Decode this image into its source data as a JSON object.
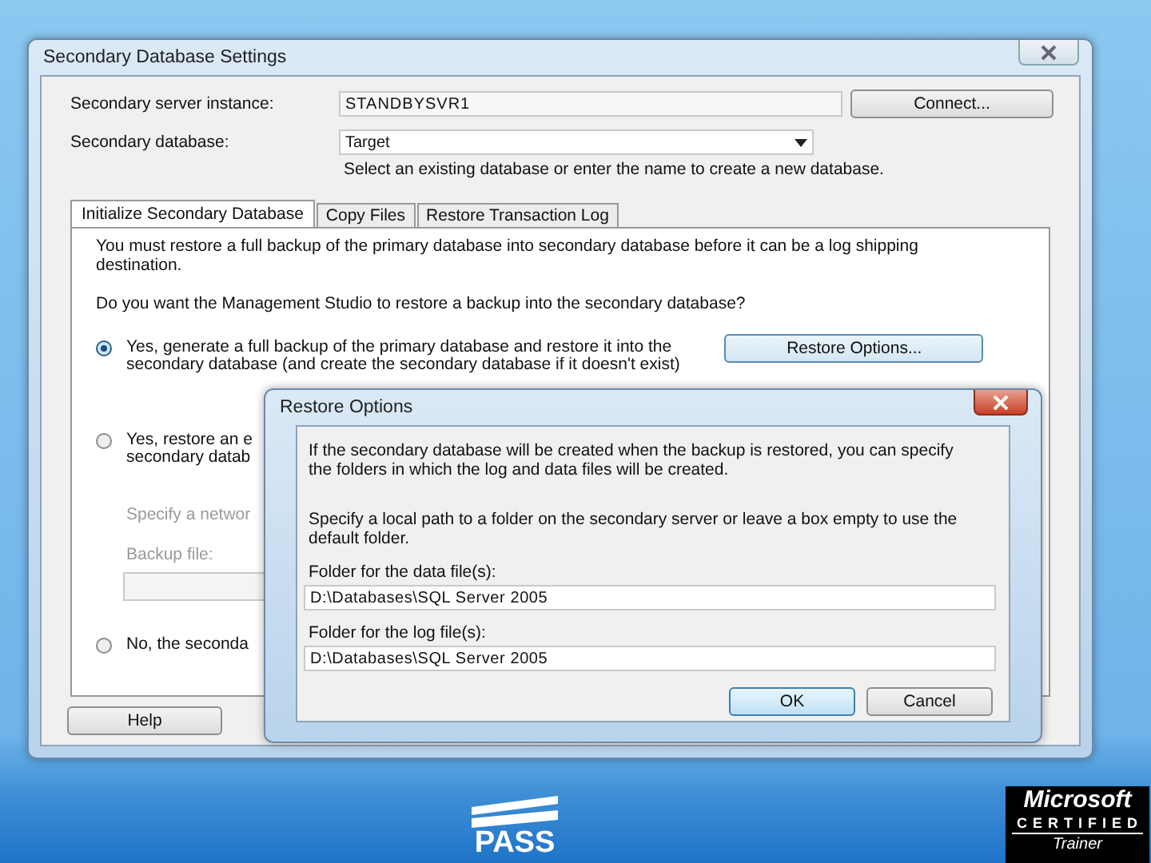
{
  "main_dialog": {
    "title": "Secondary Database Settings",
    "server_label": "Secondary server instance:",
    "server_value": "STANDBYSVR1",
    "connect_button": "Connect...",
    "database_label": "Secondary database:",
    "database_value": "Target",
    "database_hint": "Select an existing database or enter the name to create a new database.",
    "tabs": [
      {
        "label": "Initialize Secondary Database",
        "selected": true
      },
      {
        "label": "Copy Files",
        "selected": false
      },
      {
        "label": "Restore Transaction Log",
        "selected": false
      }
    ],
    "intro": "You must restore a full backup of the primary database into secondary database before it can be a log shipping destination.",
    "question": "Do you want the Management Studio to restore a backup into the secondary database?",
    "options": [
      {
        "kind": "radio",
        "selected": true,
        "lines": [
          "Yes, generate a full backup of the primary database and restore it into the",
          "secondary database (and create the secondary database if it doesn't exist)"
        ],
        "button": "Restore Options..."
      },
      {
        "kind": "radio",
        "selected": false,
        "lines": [
          "Yes, restore an e",
          "secondary datab"
        ]
      },
      {
        "kind": "note",
        "disabled": true,
        "text": "Specify a networ"
      },
      {
        "kind": "field",
        "disabled": true,
        "label": "Backup file:"
      },
      {
        "kind": "radio",
        "selected": false,
        "lines": [
          "No, the seconda"
        ]
      }
    ],
    "help_button": "Help"
  },
  "restore_options": {
    "title": "Restore Options",
    "text1": "If the secondary database will be created when the backup is restored, you can specify the folders in which the log and data files will be created.",
    "text2": "Specify a local path to a folder on the secondary server or leave a box empty to use the default folder.",
    "fields": [
      {
        "label": "Folder for the data file(s):",
        "value": "D:\\Databases\\SQL Server 2005"
      },
      {
        "label": "Folder for the log file(s):",
        "value": "D:\\Databases\\SQL Server 2005"
      }
    ],
    "buttons": [
      {
        "label": "OK",
        "default": true
      },
      {
        "label": "Cancel",
        "default": false
      }
    ]
  },
  "footer": {
    "left_logo": "PASS",
    "right_logo": [
      "Microsoft",
      "CERTIFIED",
      "Trainer"
    ]
  }
}
